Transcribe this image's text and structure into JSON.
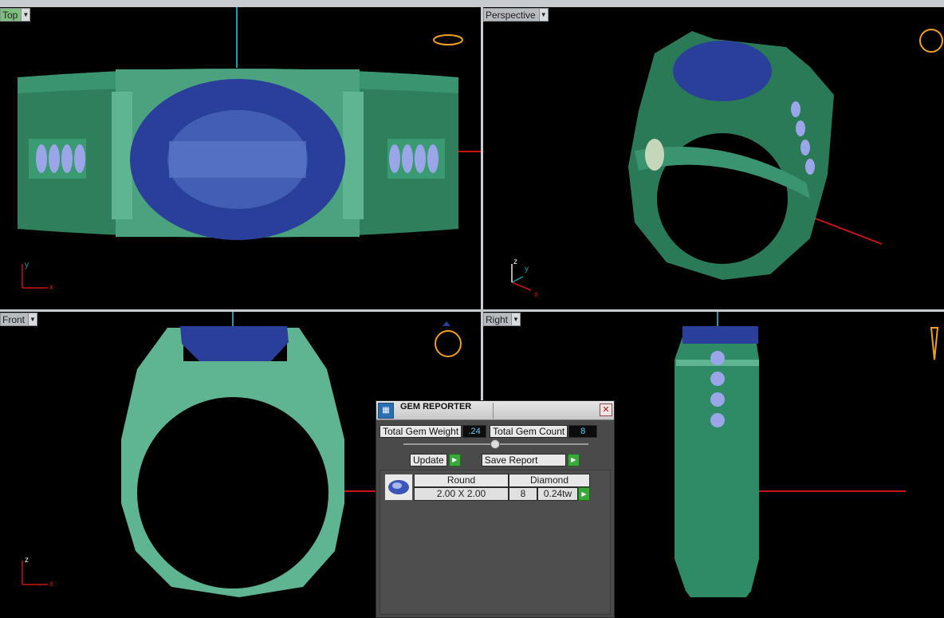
{
  "viewports": {
    "top": {
      "label": "Top",
      "dropdown": "▼"
    },
    "perspective": {
      "label": "Perspective",
      "dropdown": "▼"
    },
    "front": {
      "label": "Front",
      "dropdown": "▼"
    },
    "right": {
      "label": "Right",
      "dropdown": "▼"
    }
  },
  "axes": {
    "x": "x",
    "y": "y",
    "z": "z"
  },
  "colors": {
    "band": "#2f8a66",
    "band_light": "#5fb592",
    "gem": "#2a3f9a",
    "axis_x": "#c81414",
    "axis_y": "#1aa0a8",
    "widget": "#f0a020"
  },
  "gem_reporter": {
    "title": "GEM REPORTER",
    "close_label": "✕",
    "total_weight_label": "Total Gem Weight",
    "total_weight_value": ".24",
    "total_count_label": "Total Gem Count",
    "total_count_value": "8",
    "update_label": "Update",
    "save_report_label": "Save Report",
    "arrow": "▶",
    "rows": [
      {
        "shape": "Round",
        "material": "Diamond",
        "size": "2.00 X 2.00",
        "count": "8",
        "weight": "0.24tw"
      }
    ]
  }
}
